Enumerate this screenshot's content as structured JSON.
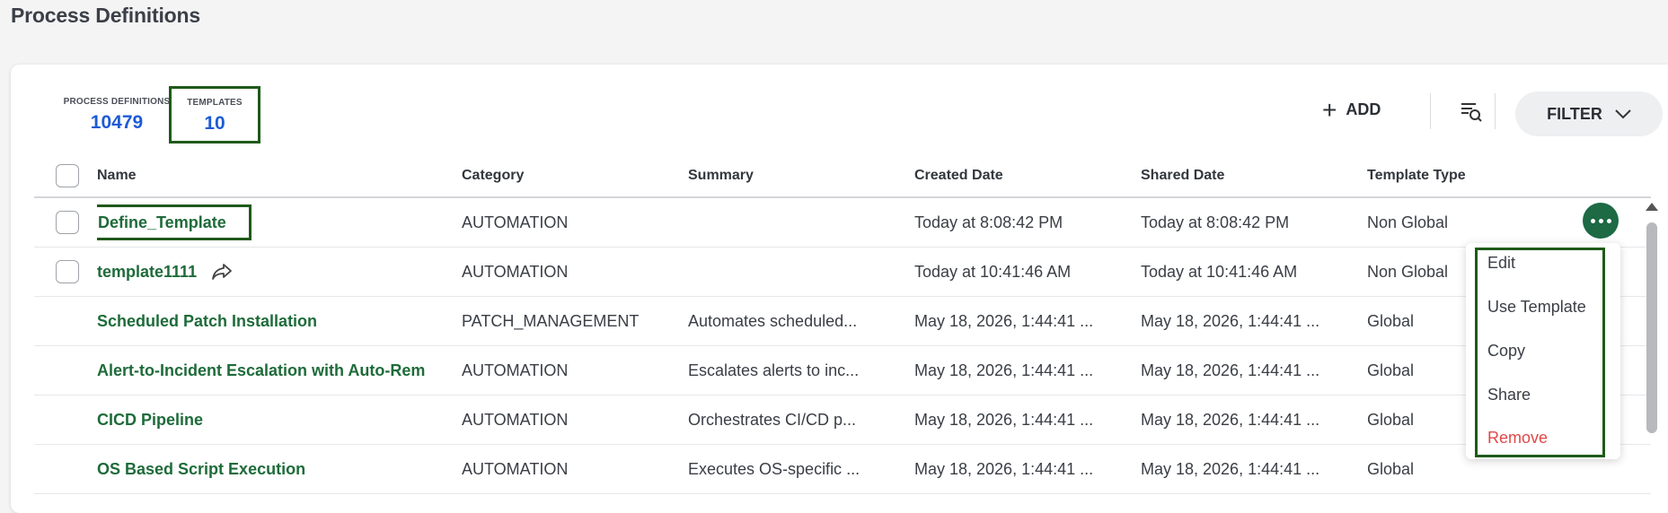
{
  "page": {
    "title": "Process Definitions"
  },
  "stats": {
    "process_definitions": {
      "label": "PROCESS DEFINITIONS",
      "value": "10479"
    },
    "templates": {
      "label": "TEMPLATES",
      "value": "10"
    }
  },
  "toolbar": {
    "add_label": "ADD",
    "filter_label": "FILTER"
  },
  "table": {
    "columns": [
      "Name",
      "Category",
      "Summary",
      "Created Date",
      "Shared Date",
      "Template Type"
    ],
    "rows": [
      {
        "name": "Define_Template",
        "category": "AUTOMATION",
        "summary": "",
        "created": "Today at 8:08:42 PM",
        "shared": "Today at 8:08:42 PM",
        "type": "Non Global"
      },
      {
        "name": "template1111",
        "category": "AUTOMATION",
        "summary": "",
        "created": "Today at 10:41:46 AM",
        "shared": "Today at 10:41:46 AM",
        "type": "Non Global"
      },
      {
        "name": "Scheduled Patch Installation",
        "category": "PATCH_MANAGEMENT",
        "summary": "Automates scheduled...",
        "created": "May 18, 2026, 1:44:41 ...",
        "shared": "May 18, 2026, 1:44:41 ...",
        "type": "Global"
      },
      {
        "name": "Alert-to-Incident Escalation with Auto-Rem",
        "category": "AUTOMATION",
        "summary": "Escalates alerts to inc...",
        "created": "May 18, 2026, 1:44:41 ...",
        "shared": "May 18, 2026, 1:44:41 ...",
        "type": "Global"
      },
      {
        "name": "CICD Pipeline",
        "category": "AUTOMATION",
        "summary": "Orchestrates CI/CD p...",
        "created": "May 18, 2026, 1:44:41 ...",
        "shared": "May 18, 2026, 1:44:41 ...",
        "type": "Global"
      },
      {
        "name": "OS Based Script Execution",
        "category": "AUTOMATION",
        "summary": "Executes OS-specific ...",
        "created": "May 18, 2026, 1:44:41 ...",
        "shared": "May 18, 2026, 1:44:41 ...",
        "type": "Global"
      }
    ]
  },
  "context_menu": {
    "items": [
      "Edit",
      "Use Template",
      "Copy",
      "Share",
      "Remove"
    ]
  },
  "icons": [
    "plus-icon",
    "search-list-icon",
    "chevron-down-icon",
    "share-arrow-icon",
    "more-horizontal-icon"
  ],
  "colors": {
    "link_green": "#1e6b3a",
    "accent_blue": "#1d5bd6",
    "more_button": "#1d6a45",
    "highlight_box": "#1f5a1a",
    "danger": "#e04848"
  }
}
